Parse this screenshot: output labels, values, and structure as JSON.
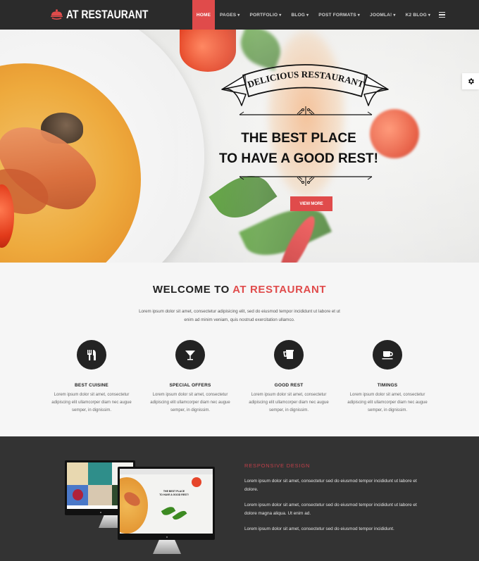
{
  "header": {
    "logo_text": "AT RESTAURANT",
    "logo_icon": "cloche-icon",
    "nav": [
      {
        "label": "HOME",
        "active": true,
        "has_dropdown": false
      },
      {
        "label": "PAGES",
        "active": false,
        "has_dropdown": true
      },
      {
        "label": "PORTFOLIO",
        "active": false,
        "has_dropdown": true
      },
      {
        "label": "BLOG",
        "active": false,
        "has_dropdown": true
      },
      {
        "label": "POST FORMATS",
        "active": false,
        "has_dropdown": true
      },
      {
        "label": "JOOMLA!",
        "active": false,
        "has_dropdown": true
      },
      {
        "label": "K2 BLOG",
        "active": false,
        "has_dropdown": true
      }
    ],
    "menu_icon": "hamburger-icon",
    "chevron": "▾"
  },
  "hero": {
    "ribbon_text": "DELICIOUS RESTAURANT",
    "title_line1": "THE BEST PLACE",
    "title_line2": "TO HAVE A GOOD REST!",
    "button_label": "VIEW MORE",
    "settings_icon": "gear-icon"
  },
  "welcome": {
    "title_prefix": "WELCOME TO",
    "title_accent": "AT RESTAURANT",
    "intro": "Lorem ipsum dolor sit amet, consectetur adipisicing elit, sed do eiusmod tempor incididunt ut labore et ut enim ad minim veniam, quis nostrud exercitation ullamco.",
    "features": [
      {
        "icon": "cutlery-icon",
        "title": "BEST CUISINE",
        "text": "Lorem ipsum dolor sit amet, consectetur adipiscing elit ullamcorper diam nec augue semper, in dignissim."
      },
      {
        "icon": "cocktail-glass-icon",
        "title": "SPECIAL OFFERS",
        "text": "Lorem ipsum dolor sit amet, consectetur adipiscing elit ullamcorper diam nec augue semper, in dignissim."
      },
      {
        "icon": "beer-mug-icon",
        "title": "GOOD REST",
        "text": "Lorem ipsum dolor sit amet, consectetur adipiscing elit ullamcorper diam nec augue semper, in dignissim."
      },
      {
        "icon": "coffee-cup-icon",
        "title": "TIMINGS",
        "text": "Lorem ipsum dolor sit amet, consectetur adipiscing elit ullamcorper diam nec augue semper, in dignissim."
      }
    ]
  },
  "responsive": {
    "title": "RESPONSIVE DESIGN",
    "paragraphs": [
      "Lorem ipsum dolor sit amet, consectetur sed do eiusmod tempor incididunt ut labore et dolore.",
      "Lorem ipsum dolor sit amet, consectetur sed do eiusmod tempor incididunt ut labore et dolore magna aliqua. Ut enim ad.",
      "Lorem ipsum dolor sit amet, consectetur sed do eiusmod tempor incididunt."
    ],
    "mockup_screen_text": [
      "THE BEST PLACE",
      "TO HAVE A GOOD REST!"
    ]
  },
  "colors": {
    "accent": "#e04b4b",
    "header_bg": "#2b2b2b",
    "dark_section_bg": "#333333",
    "light_bg": "#f6f6f6",
    "responsive_title": "#c0404a"
  }
}
